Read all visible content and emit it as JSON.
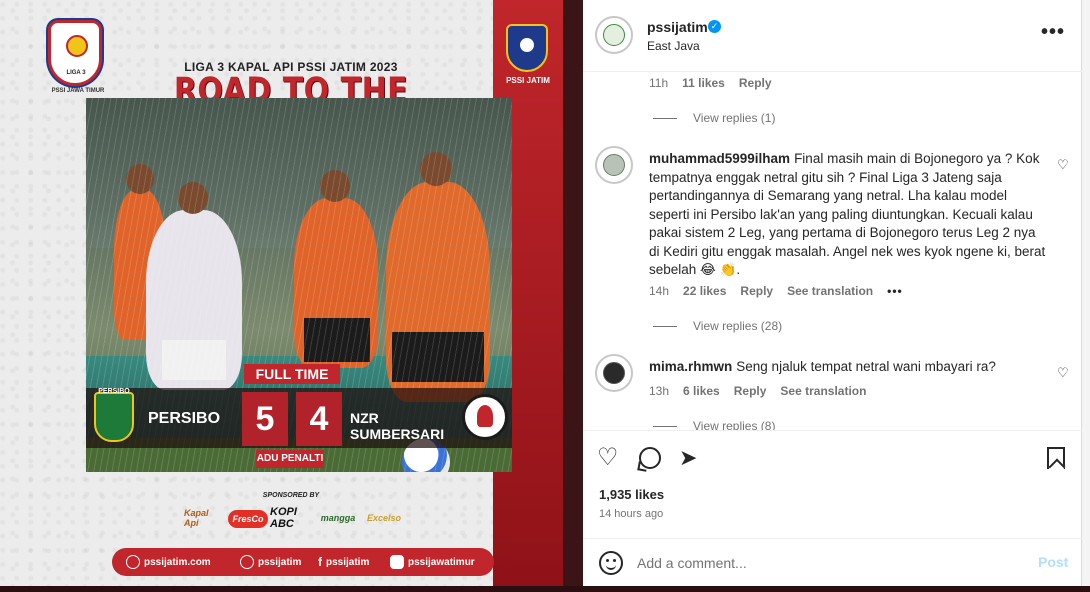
{
  "post_image": {
    "liga_logo_text": "LIGA 3",
    "liga_caption": "PSSI JAWA TIMUR",
    "pssi_caption": "PSSI JATIM",
    "league_title": "LIGA 3 KAPAL API PSSI JATIM 2023",
    "headline": "ROAD TO THE FINAL",
    "full_time_label": "FULL TIME",
    "home_team": "PERSIBO",
    "home_badge_text": "PERSIBO",
    "home_score": "5",
    "away_score": "4",
    "away_team": "NZR SUMBERSARI",
    "penalty_label": "ADU PENALTI",
    "sponsored_by": "SPONSORED BY",
    "sponsors": [
      "Kapal Api",
      "FresCo",
      "KOPI ABC",
      "mangga",
      "Excelso"
    ],
    "footer": [
      "pssijatim.com",
      "pssijatim",
      "pssijatim",
      "pssijawatimur"
    ]
  },
  "header": {
    "account": "pssijatim",
    "location": "East Java",
    "verified_icon": "verified-badge-icon",
    "more_icon": "more-options-icon"
  },
  "comments": {
    "first_meta": {
      "time": "11h",
      "likes": "11 likes",
      "reply": "Reply"
    },
    "first_view_replies": "View replies (1)",
    "items": [
      {
        "user": "muhammad5999ilham",
        "text": "Final masih main di Bojonegoro ya ? Kok tempatnya enggak netral gitu sih ? Final Liga 3 Jateng saja pertandingannya di Semarang yang netral. Lha kalau model seperti ini Persibo lak'an yang paling diuntungkan. Kecuali kalau pakai sistem 2 Leg, yang pertama di Bojonegoro terus Leg 2 nya di Kediri gitu enggak masalah. Angel nek wes kyok ngene ki, berat sebelah 😂 👏.",
        "time": "14h",
        "likes": "22 likes",
        "reply": "Reply",
        "translate": "See translation",
        "more": "•••",
        "view_replies": "View replies (28)"
      },
      {
        "user": "mima.rhmwn",
        "text": "Seng njaluk tempat netral wani mbayari ra?",
        "time": "13h",
        "likes": "6 likes",
        "reply": "Reply",
        "translate": "See translation",
        "view_replies": "View replies (8)"
      }
    ]
  },
  "actions": {
    "likes": "1,935 likes",
    "posted": "14 hours ago"
  },
  "composer": {
    "placeholder": "Add a comment...",
    "post_label": "Post"
  },
  "colors": {
    "brand_red": "#c0262b",
    "verified_blue": "#0095f6",
    "post_disabled": "#b2dffc"
  }
}
